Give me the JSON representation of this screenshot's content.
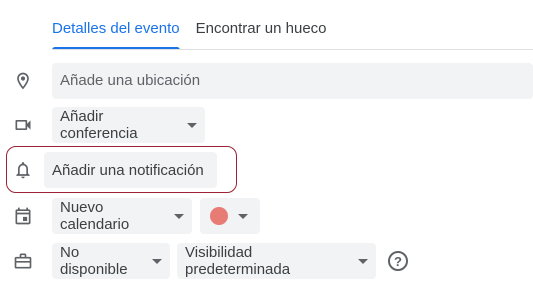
{
  "tabs": [
    {
      "label": "Detalles del evento",
      "active": true
    },
    {
      "label": "Encontrar un hueco",
      "active": false
    }
  ],
  "location": {
    "placeholder": "Añade una ubicación",
    "icon": "location-pin-icon"
  },
  "conference": {
    "label": "Añadir conferencia",
    "icon": "video-camera-icon"
  },
  "notification": {
    "label": "Añadir una notificación",
    "icon": "bell-icon"
  },
  "calendar": {
    "label": "Nuevo calendario",
    "icon": "calendar-icon",
    "color": "#e67c73"
  },
  "availability": {
    "label": "No disponible",
    "icon": "briefcase-icon"
  },
  "visibility": {
    "label": "Visibilidad predeterminada",
    "help": "?"
  },
  "colors": {
    "accent": "#1a73e8",
    "highlight_border": "#9b2335"
  }
}
